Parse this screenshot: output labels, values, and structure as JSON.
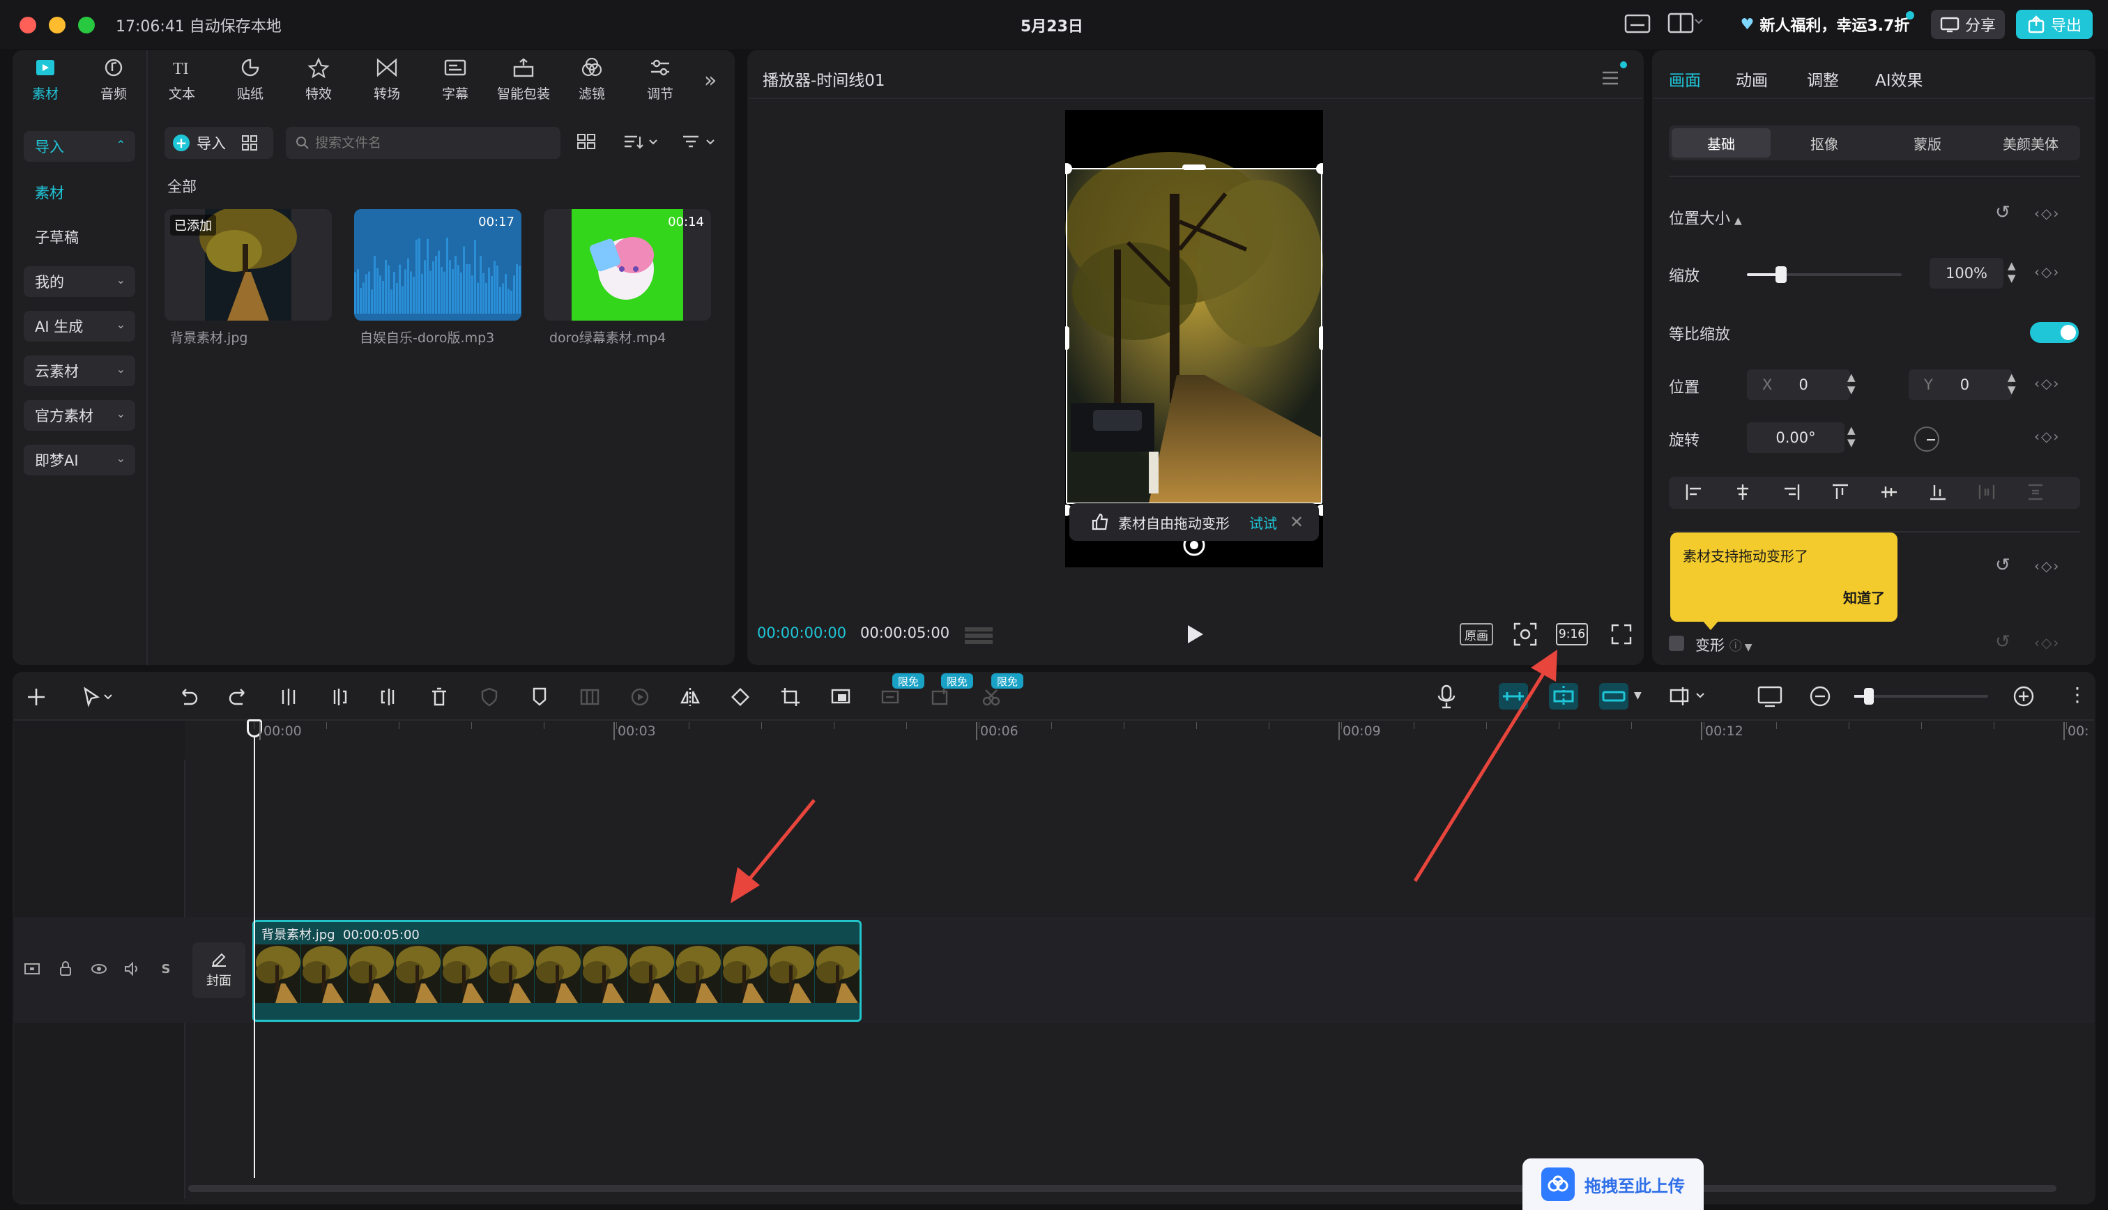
{
  "titlebar": {
    "autosave": "17:06:41 自动保存本地",
    "project_title": "5月23日",
    "promo": "新人福利，幸运3.7折",
    "share_label": "分享",
    "export_label": "导出"
  },
  "tools": [
    {
      "label": "素材",
      "icon": "media-icon",
      "active": true
    },
    {
      "label": "音频",
      "icon": "audio-icon"
    },
    {
      "label": "文本",
      "icon": "text-icon"
    },
    {
      "label": "贴纸",
      "icon": "sticker-icon"
    },
    {
      "label": "特效",
      "icon": "effects-icon"
    },
    {
      "label": "转场",
      "icon": "transition-icon"
    },
    {
      "label": "字幕",
      "icon": "subtitle-icon"
    },
    {
      "label": "智能包装",
      "icon": "smart-pack-icon"
    },
    {
      "label": "滤镜",
      "icon": "filter-icon"
    },
    {
      "label": "调节",
      "icon": "adjust-icon"
    }
  ],
  "left_nav": [
    {
      "label": "导入",
      "active": true,
      "chevron": "up"
    },
    {
      "label": "素材",
      "active": true,
      "plain": true
    },
    {
      "label": "子草稿",
      "plain": true
    },
    {
      "label": "我的",
      "chevron": "down"
    },
    {
      "label": "AI 生成",
      "chevron": "down"
    },
    {
      "label": "云素材",
      "chevron": "down"
    },
    {
      "label": "官方素材",
      "chevron": "down"
    },
    {
      "label": "即梦AI",
      "chevron": "down"
    }
  ],
  "media": {
    "import_label": "导入",
    "search_placeholder": "搜索文件名",
    "section_label": "全部",
    "items": [
      {
        "name": "背景素材.jpg",
        "badge": "已添加",
        "duration": ""
      },
      {
        "name": "自娱自乐-doro版.mp3",
        "badge": "",
        "duration": "00:17"
      },
      {
        "name": "doro绿幕素材.mp4",
        "badge": "",
        "duration": "00:14"
      }
    ]
  },
  "player": {
    "title": "播放器-时间线01",
    "tooltip_text": "素材自由拖动变形",
    "tooltip_try": "试试",
    "current_time": "00:00:00:00",
    "total_time": "00:00:05:00",
    "original_label": "原画",
    "ratio_label": "9:16"
  },
  "inspector": {
    "tabs": [
      "画面",
      "动画",
      "调整",
      "AI效果"
    ],
    "subtabs": [
      "基础",
      "抠像",
      "蒙版",
      "美颜美体"
    ],
    "section_title": "位置大小",
    "scale_label": "缩放",
    "scale_value": "100%",
    "scale_fraction": 0.22,
    "ratio_lock_label": "等比缩放",
    "ratio_lock_on": true,
    "position_label": "位置",
    "x_label": "X",
    "x_value": "0",
    "y_label": "Y",
    "y_value": "0",
    "rotate_label": "旋转",
    "rotate_value": "0.00°",
    "tip_text": "素材支持拖动变形了",
    "tip_button": "知道了",
    "transform_label": "变形"
  },
  "timeline": {
    "badges": [
      "限免",
      "限免",
      "限免"
    ],
    "ruler": [
      "00:00",
      "00:03",
      "00:06",
      "00:09",
      "00:12",
      "00:"
    ],
    "cover_label": "封面",
    "clip_name": "背景素材.jpg",
    "clip_duration": "00:00:05:00",
    "upload_label": "拖拽至此上传"
  },
  "colors": {
    "accent": "#1fc6d8",
    "panel": "#1f1f22",
    "clip_border": "#23c3c9",
    "tip_yellow": "#f3cb2c",
    "arrow": "#e8453c"
  }
}
